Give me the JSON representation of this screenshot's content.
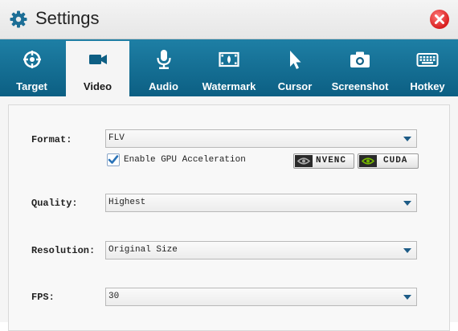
{
  "window": {
    "title": "Settings"
  },
  "tabs": [
    {
      "label": "Target",
      "icon": "target-icon"
    },
    {
      "label": "Video",
      "icon": "video-camera-icon",
      "active": true
    },
    {
      "label": "Audio",
      "icon": "microphone-icon"
    },
    {
      "label": "Watermark",
      "icon": "watermark-icon"
    },
    {
      "label": "Cursor",
      "icon": "cursor-icon"
    },
    {
      "label": "Screenshot",
      "icon": "camera-icon"
    },
    {
      "label": "Hotkey",
      "icon": "keyboard-icon"
    }
  ],
  "video": {
    "format": {
      "label": "Format:",
      "value": "FLV"
    },
    "gpu": {
      "label": "Enable GPU Acceleration",
      "checked": true,
      "nvenc": "NVENC",
      "cuda": "CUDA"
    },
    "quality": {
      "label": "Quality:",
      "value": "Highest"
    },
    "resolution": {
      "label": "Resolution:",
      "value": "Original Size"
    },
    "fps": {
      "label": "FPS:",
      "value": "30"
    }
  },
  "colors": {
    "accent": "#0c5f83",
    "close": "#d81e1e",
    "nvidia_green": "#76b900"
  }
}
